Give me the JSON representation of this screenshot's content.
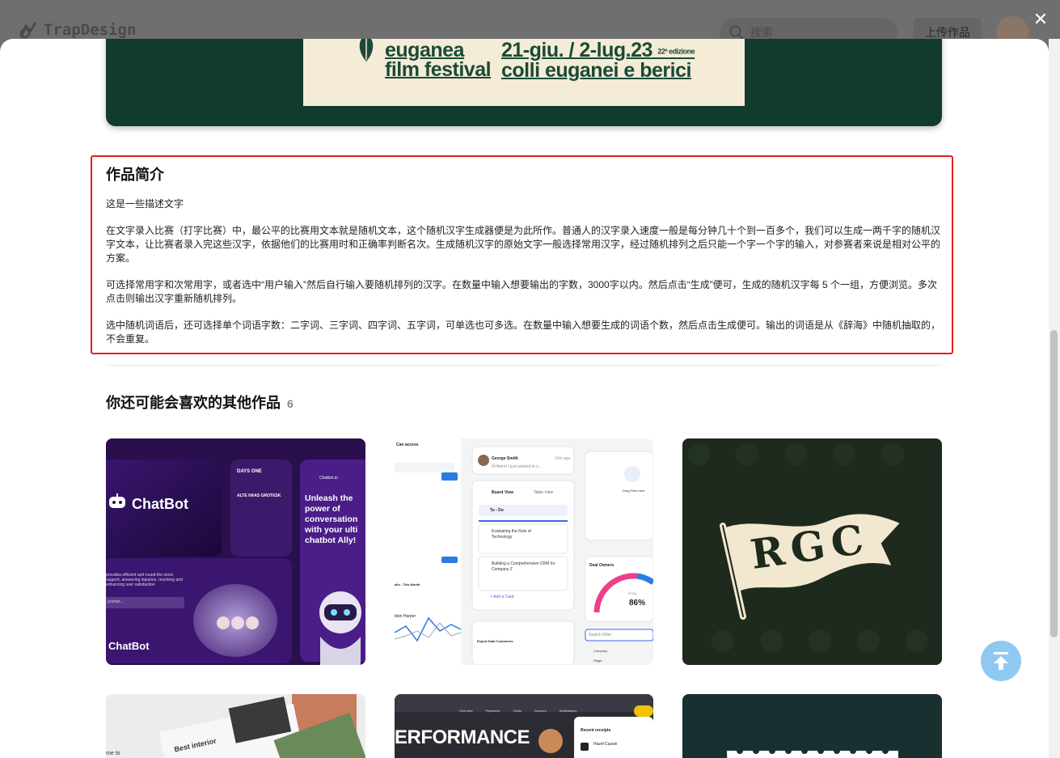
{
  "background": {
    "logo_text": "TrapDesign",
    "search_placeholder": "搜索",
    "upload_label": "上传作品"
  },
  "close_label": "✕",
  "hero": {
    "poster_left_line1": "euganea",
    "poster_left_line2": "film festival",
    "poster_right_line1": "21-giu. / 2-lug.23",
    "poster_right_edition": "22ª edizione",
    "poster_right_line2": "colli euganei e berici"
  },
  "description": {
    "title": "作品简介",
    "paragraphs": [
      "这是一些描述文字",
      "在文字录入比赛（打字比赛）中，最公平的比赛用文本就是随机文本，这个随机汉字生成器便是为此所作。普通人的汉字录入速度一般是每分钟几十个到一百多个，我们可以生成一两千字的随机汉字文本，让比赛者录入完这些汉字，依据他们的比赛用时和正确率判断名次。生成随机汉字的原始文字一般选择常用汉字，经过随机排列之后只能一个字一个字的输入，对参赛者来说是相对公平的方案。",
      "可选择常用字和次常用字，或者选中“用户输入”然后自行输入要随机排列的汉字。在数量中输入想要输出的字数，3000字以内。然后点击“生成”便可，生成的随机汉字每 5 个一组，方便浏览。多次点击则输出汉字重新随机排列。",
      "选中随机词语后，还可选择单个词语字数：二字词、三字词、四字词、五字词，可单选也可多选。在数量中输入想要生成的词语个数，然后点击生成便可。输出的词语是从《辞海》中随机抽取的，不会重复。"
    ]
  },
  "more": {
    "title": "你还可能会喜欢的其他作品",
    "count": "6"
  },
  "cards": {
    "chatbot": {
      "brand": "ChatBot",
      "brand_bottom": "ChatBot",
      "font_title": "DAYS ONE",
      "font_sub": "ALTE HAAS GROTESK",
      "tagline": "Unleash the power of conversation with your ulti chatbot Ally!",
      "site": "Chatbot.io",
      "desc": "provides efficient and round-the-clock support, answering inquiries, resolving and enhancing user satisfaction",
      "prompt": "prompt..."
    },
    "dashboard": {
      "access_title": "Can access",
      "user_name": "George Smith",
      "user_time": "10m ago",
      "user_msg": "Hi there! I just wanted to s...",
      "board_tab": "Board View",
      "table_tab": "Table View",
      "todo": "To - Do",
      "task1": "Evaluating the Role of Technology",
      "task2": "Building a Comprehensive CRM for Company Z",
      "add_card": "+ Add a Card",
      "drag_files": "Drag Files here",
      "deal_owners": "Deal Owners",
      "total_label": "TOTAL",
      "total_value": "86%",
      "search_filter": "Search Filter",
      "company": "Company",
      "stage": "Stage",
      "export": "Export Data Customers",
      "month": "alls - This Month",
      "person": "lden Harper"
    },
    "rgc": {
      "letters": "RGC"
    },
    "interior": {
      "text1": "Best interior",
      "text2": "me to"
    },
    "performance": {
      "headline": "ERFORMANCE",
      "receipts": "Recent receipts",
      "receipt_name": "Hazel Cassin",
      "nav": [
        "Overview",
        "Payments",
        "Cards",
        "Account",
        "Notifications"
      ]
    }
  },
  "back_to_top": "↑"
}
